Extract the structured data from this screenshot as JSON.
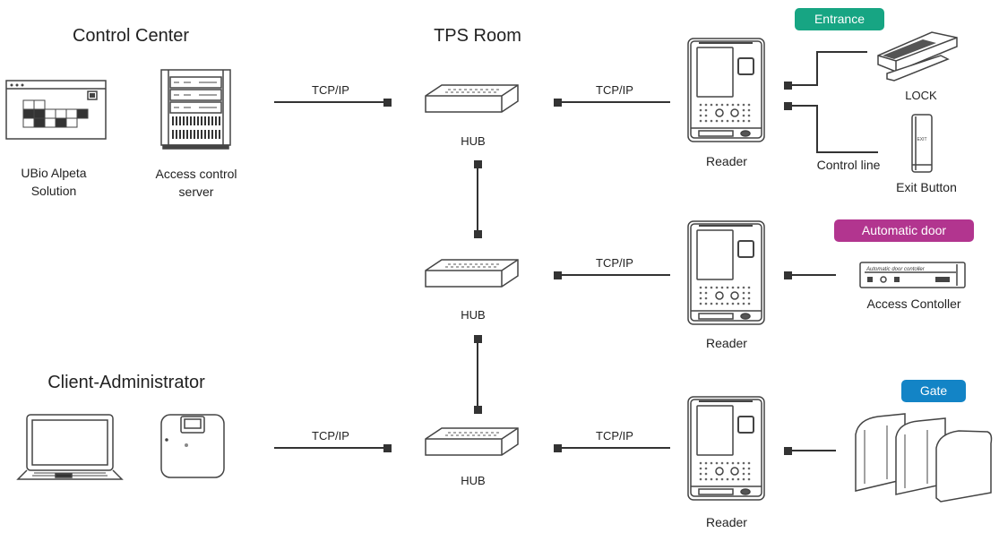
{
  "sections": {
    "control_center": "Control Center",
    "tps_room": "TPS Room",
    "client_admin": "Client-Administrator"
  },
  "devices": {
    "software": [
      "UBio Alpeta",
      "Solution"
    ],
    "server": [
      "Access control",
      "server"
    ],
    "hub": "HUB",
    "reader": "Reader",
    "lock": "LOCK",
    "exit_button": "Exit Button",
    "control_line": "Control line",
    "access_controller": "Access Contoller",
    "controller_panel_text": "Automatic door contoller",
    "exit_button_text": "EXIT"
  },
  "links": {
    "tcpip": "TCP/IP"
  },
  "badges": {
    "entrance": {
      "label": "Entrance",
      "color": "#17a583"
    },
    "automatic_door": {
      "label": "Automatic door",
      "color": "#b2358f"
    },
    "gate": {
      "label": "Gate",
      "color": "#1384c6"
    }
  },
  "colors": {
    "line": "#333333",
    "icon_stroke": "#444444"
  }
}
